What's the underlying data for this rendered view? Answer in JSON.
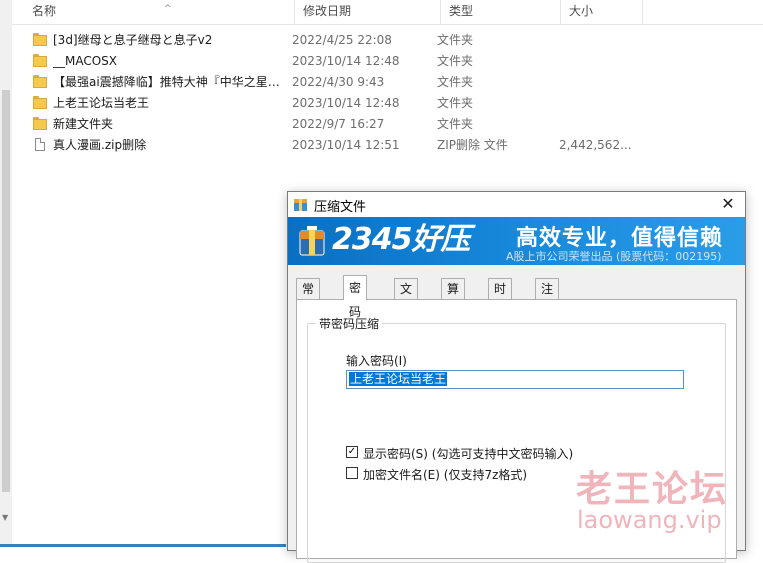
{
  "columns": {
    "name": "名称",
    "date": "修改日期",
    "type": "类型",
    "size": "大小"
  },
  "files": [
    {
      "icon": "folder-icon",
      "name": "[3d]继母と息子继母と息子v2",
      "date": "2022/4/25 22:08",
      "type": "文件夹",
      "size": ""
    },
    {
      "icon": "folder-icon",
      "name": "__MACOSX",
      "date": "2023/10/14 12:48",
      "type": "文件夹",
      "size": ""
    },
    {
      "icon": "folder-icon",
      "name": "【最强ai震撼降临】推特大神『中华之星…",
      "date": "2022/4/30 9:43",
      "type": "文件夹",
      "size": ""
    },
    {
      "icon": "folder-icon",
      "name": "上老王论坛当老王",
      "date": "2023/10/14 12:48",
      "type": "文件夹",
      "size": ""
    },
    {
      "icon": "folder-icon",
      "name": "新建文件夹",
      "date": "2022/9/7 16:27",
      "type": "文件夹",
      "size": ""
    },
    {
      "icon": "document-icon",
      "name": "真人漫画.zip删除",
      "date": "2023/10/14 12:51",
      "type": "ZIP删除 文件",
      "size": "2,442,562..."
    }
  ],
  "dialog": {
    "title": "压缩文件",
    "close_glyph": "✕",
    "banner": {
      "brand": "2345好压",
      "slogan": "高效专业，值得信赖",
      "sub": "A股上市公司荣誉出品 (股票代码：002195)"
    },
    "tabs": [
      {
        "label": "常规",
        "active": false
      },
      {
        "label": "密码",
        "active": true
      },
      {
        "label": "文件",
        "active": false
      },
      {
        "label": "算法",
        "active": false
      },
      {
        "label": "时间",
        "active": false
      },
      {
        "label": "注释",
        "active": false
      }
    ],
    "group_title": "带密码压缩",
    "password_label": "输入密码(I)",
    "password_value": "上老王论坛当老王",
    "show_password": {
      "label": "显示密码(S)  (勾选可支持中文密码输入)",
      "checked": true,
      "glyph": "✓"
    },
    "encrypt_names": {
      "label": "加密文件名(E)  (仅支持7z格式)",
      "checked": false
    }
  },
  "watermark": {
    "cn": "老王论坛",
    "en": "laowang.vip"
  },
  "colors": {
    "accent": "#0078d7",
    "banner": "#1686d9",
    "folder": "#f5c94b",
    "watermark": "#e27882"
  }
}
